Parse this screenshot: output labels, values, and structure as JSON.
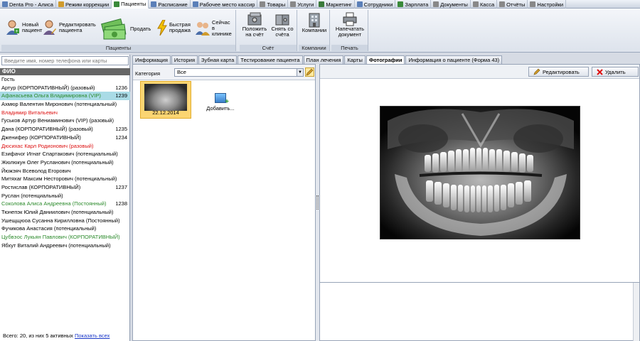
{
  "top_tabs": [
    {
      "label": "Denta Pro - Алиса",
      "icon": "app-icon",
      "color": "#5a7fb8"
    },
    {
      "label": "Режим коррекции",
      "icon": "pencil-icon",
      "color": "#d09b2c"
    },
    {
      "label": "Пациенты",
      "icon": "patients-icon",
      "color": "#3a8a3a"
    },
    {
      "label": "Расписание",
      "icon": "calendar-icon",
      "color": "#5a7fb8"
    },
    {
      "label": "Рабочее место кассир",
      "icon": "cash-desk-icon",
      "color": "#5a7fb8"
    },
    {
      "label": "Товары",
      "icon": "goods-icon",
      "color": "#888888"
    },
    {
      "label": "Услуги",
      "icon": "services-icon",
      "color": "#888888"
    },
    {
      "label": "Маркетинг",
      "icon": "marketing-icon",
      "color": "#3a7a3a"
    },
    {
      "label": "Сотрудники",
      "icon": "staff-icon",
      "color": "#5a7fb8"
    },
    {
      "label": "Зарплата",
      "icon": "salary-icon",
      "color": "#3a8a3a"
    },
    {
      "label": "Документы",
      "icon": "documents-icon",
      "color": "#888888"
    },
    {
      "label": "Касса",
      "icon": "cashbox-icon",
      "color": "#888888"
    },
    {
      "label": "Отчёты",
      "icon": "reports-icon",
      "color": "#888888"
    },
    {
      "label": "Настройки",
      "icon": "settings-icon",
      "color": "#888888"
    }
  ],
  "ribbon": {
    "patients_group": "Пациенты",
    "new_patient": "Новый пациент",
    "edit_patient": "Редактировать пациента",
    "sell": "Продать",
    "quick_sale": "Быстрая продажа",
    "now_in_clinic": "Сейчас в клинике",
    "account_group": "Счёт",
    "deposit": "Положить на счёт",
    "withdraw": "Снять со счёта",
    "companies_group": "Компании",
    "companies": "Компании",
    "print_group": "Печать",
    "print_doc": "Напечатать документ"
  },
  "search": {
    "placeholder": "Введите имя, номер телефона или карты"
  },
  "patients_header": "ФИО",
  "patients": [
    {
      "name": "Гость",
      "num": "",
      "color": "#000000",
      "selected": false
    },
    {
      "name": "Артур (КОРПОРАТИВНЫЙ) (разовый)",
      "num": "1236",
      "color": "#000000",
      "selected": false
    },
    {
      "name": "Афанасьева Ольга Владимировна (VIP)",
      "num": "1239",
      "color": "#2b8a2b",
      "selected": true
    },
    {
      "name": "Ахмюр Валентин Миронович (потенциальный)",
      "num": "",
      "color": "#000000",
      "selected": false
    },
    {
      "name": "Владимир Витальевич",
      "num": "",
      "color": "#dd1111",
      "selected": false
    },
    {
      "name": "Гуськов Артур Вениаминович (VIP) (разовый)",
      "num": "",
      "color": "#000000",
      "selected": false
    },
    {
      "name": "Дана (КОРПОРАТИВНЫЙ) (разовый)",
      "num": "1235",
      "color": "#000000",
      "selected": false
    },
    {
      "name": "Дженифер (КОРПОРАТИВНЫЙ)",
      "num": "1234",
      "color": "#000000",
      "selected": false
    },
    {
      "name": "Дюсихас Карл Родионович (разовый)",
      "num": "",
      "color": "#dd1111",
      "selected": false
    },
    {
      "name": "Езифачог Игнат Спартакович (потенциальный)",
      "num": "",
      "color": "#000000",
      "selected": false
    },
    {
      "name": "Жюлюкун Олег Русланович (потенциальный)",
      "num": "",
      "color": "#000000",
      "selected": false
    },
    {
      "name": "Йюжэяч Всеволод Егорович",
      "num": "",
      "color": "#000000",
      "selected": false
    },
    {
      "name": "Митяхаг Максим Несторович (потенциальный)",
      "num": "",
      "color": "#000000",
      "selected": false
    },
    {
      "name": "Ростислав (КОРПОРАТИВНЫЙ)",
      "num": "1237",
      "color": "#000000",
      "selected": false
    },
    {
      "name": "Руслан (потенциальный)",
      "num": "",
      "color": "#000000",
      "selected": false
    },
    {
      "name": "Соколова Алиса Андреевна (Постоянный)",
      "num": "1238",
      "color": "#2b8a2b",
      "selected": false
    },
    {
      "name": "Тюнепэк Юлий Даниилович (потенциальный)",
      "num": "",
      "color": "#000000",
      "selected": false
    },
    {
      "name": "Ушещщюоа Сусанна Кирилловна (Постоянный)",
      "num": "",
      "color": "#000000",
      "selected": false
    },
    {
      "name": "Фучикова Анастасия (потенциальный)",
      "num": "",
      "color": "#000000",
      "selected": false
    },
    {
      "name": "Цубвэос Лукьян Павлович (КОРПОРАТИВНЫЙ)",
      "num": "",
      "color": "#2b8a2b",
      "selected": false
    },
    {
      "name": "Ябхут Виталий Андреевич (потенциальный)",
      "num": "",
      "color": "#000000",
      "selected": false
    }
  ],
  "footer": {
    "text": "Всего: 20, из них 5 активных",
    "link": "Показать всех"
  },
  "content_tabs": [
    {
      "label": "Информация",
      "active": false
    },
    {
      "label": "История",
      "active": false
    },
    {
      "label": "Зубная карта",
      "active": false
    },
    {
      "label": "Тестирование пациента",
      "active": false
    },
    {
      "label": "План лечения",
      "active": false
    },
    {
      "label": "Карты",
      "active": false
    },
    {
      "label": "Фотографии",
      "active": true
    },
    {
      "label": "Информация о пациенте (Форма 43)",
      "active": false
    }
  ],
  "photos": {
    "category_label": "Категория",
    "category_value": "Все",
    "thumb_date": "22.12.2014",
    "add_label": "Добавить..."
  },
  "viewer": {
    "edit_label": "Редактировать",
    "delete_label": "Удалить"
  }
}
